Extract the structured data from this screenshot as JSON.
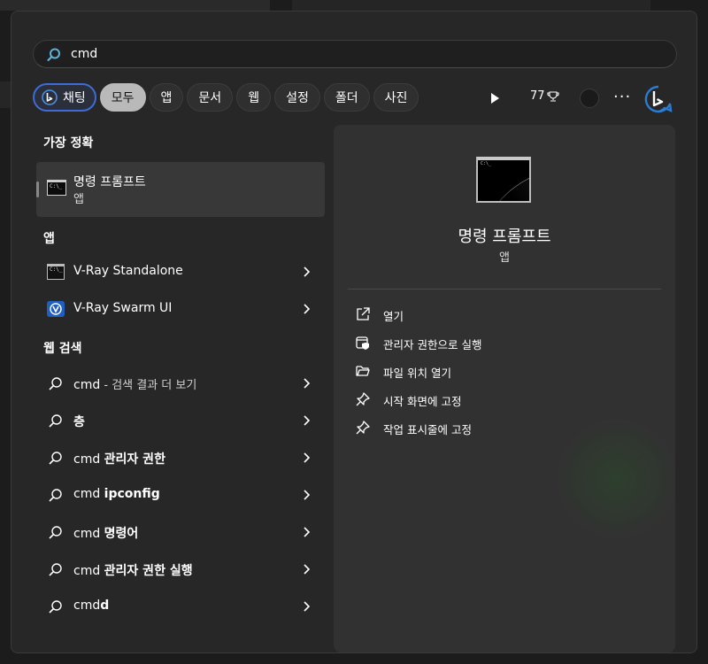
{
  "search": {
    "query": "cmd"
  },
  "filters": [
    {
      "label": "채팅",
      "icon": "bing-chat-icon",
      "active": false
    },
    {
      "label": "모두",
      "active": true
    },
    {
      "label": "앱",
      "active": false
    },
    {
      "label": "문서",
      "active": false
    },
    {
      "label": "웹",
      "active": false
    },
    {
      "label": "설정",
      "active": false
    },
    {
      "label": "폴더",
      "active": false
    },
    {
      "label": "사진",
      "active": false
    }
  ],
  "toolbar": {
    "points": "77",
    "more": "···"
  },
  "best_match": {
    "heading": "가장 정확",
    "title": "명령 프롬프트",
    "subtitle": "앱"
  },
  "apps": {
    "heading": "앱",
    "items": [
      {
        "label": "V-Ray Standalone",
        "icon": "console-app-icon"
      },
      {
        "label": "V-Ray Swarm UI",
        "icon": "vray-swarm-icon"
      }
    ]
  },
  "web": {
    "heading": "웹 검색",
    "items": [
      {
        "prefix": "cmd",
        "suffix": " - 검색 결과 더 보기"
      },
      {
        "prefix": "",
        "suffix": "층"
      },
      {
        "prefix": "cmd ",
        "suffix": "관리자 권한"
      },
      {
        "prefix": "cmd ",
        "suffix": "ipconfig"
      },
      {
        "prefix": "cmd ",
        "suffix": "명령어"
      },
      {
        "prefix": "cmd ",
        "suffix": "관리자 권한 실행"
      },
      {
        "prefix": "cmd",
        "suffix": "d"
      }
    ]
  },
  "preview": {
    "title": "명령 프롬프트",
    "subtitle": "앱",
    "actions": [
      {
        "label": "열기",
        "icon": "open-external-icon"
      },
      {
        "label": "관리자 권한으로 실행",
        "icon": "run-as-admin-icon"
      },
      {
        "label": "파일 위치 열기",
        "icon": "folder-open-icon"
      },
      {
        "label": "시작 화면에 고정",
        "icon": "pin-icon"
      },
      {
        "label": "작업 표시줄에 고정",
        "icon": "pin-icon"
      }
    ]
  },
  "colors": {
    "panel": "#272727",
    "preview": "#313131",
    "accent_chat": "#3f6bd6",
    "active_chip": "#b9b9b9"
  }
}
